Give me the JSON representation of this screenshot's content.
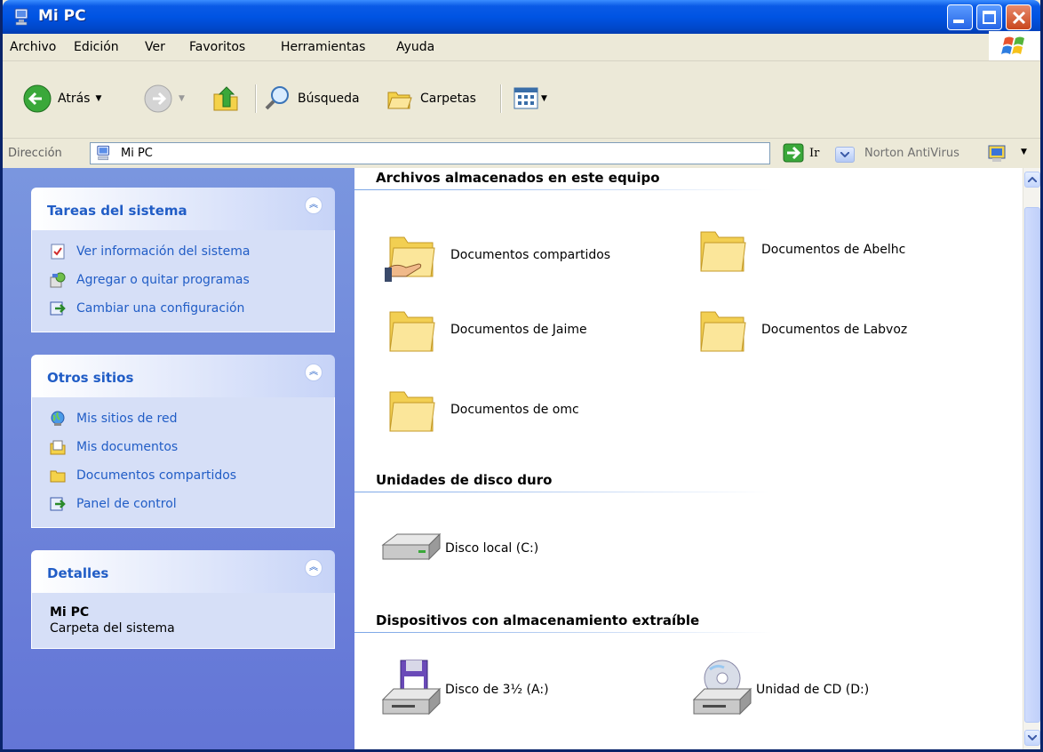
{
  "window": {
    "title": "Mi PC"
  },
  "menu": {
    "items": [
      "Archivo",
      "Edición",
      "Ver",
      "Favoritos",
      "Herramientas",
      "Ayuda"
    ]
  },
  "toolbar": {
    "back_label": "Atrás",
    "search_label": "Búsqueda",
    "folders_label": "Carpetas"
  },
  "address": {
    "label": "Dirección",
    "value": "Mi PC",
    "go_label": "Ir",
    "norton_label": "Norton AntiVirus"
  },
  "left_pane": {
    "system_tasks": {
      "title": "Tareas del sistema",
      "items": [
        "Ver información del sistema",
        "Agregar o quitar programas",
        "Cambiar una configuración"
      ]
    },
    "other_places": {
      "title": "Otros sitios",
      "items": [
        "Mis sitios de red",
        "Mis documentos",
        "Documentos compartidos",
        "Panel de control"
      ]
    },
    "details": {
      "title": "Detalles",
      "name": "Mi PC",
      "description": "Carpeta del sistema"
    }
  },
  "content": {
    "groups": [
      {
        "title": "Archivos almacenados en este equipo",
        "items": [
          "Documentos compartidos",
          "Documentos de Abelhc",
          "Documentos de Jaime",
          "Documentos de Labvoz",
          "Documentos de omc"
        ]
      },
      {
        "title": "Unidades de disco duro",
        "items": [
          "Disco local (C:)"
        ]
      },
      {
        "title": "Dispositivos con almacenamiento extraíble",
        "items": [
          "Disco de 3½ (A:)",
          "Unidad de CD (D:)"
        ]
      }
    ]
  },
  "colors": {
    "title_bar": "#0054e3",
    "task_pane": "#6f87dc",
    "link_text": "#215dc6"
  }
}
